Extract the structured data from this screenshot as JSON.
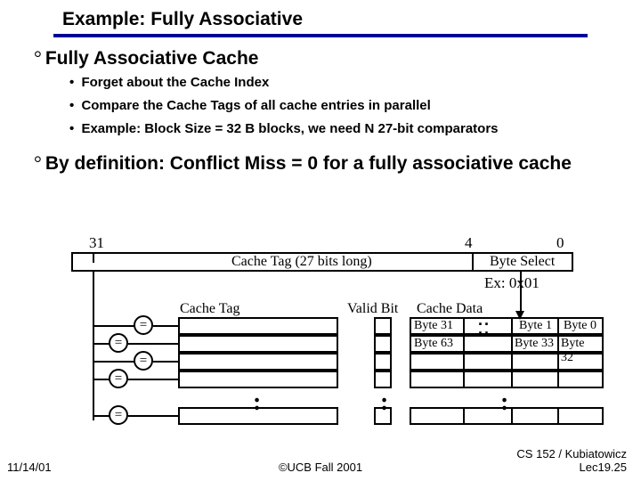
{
  "title": "Example: Fully Associative",
  "bullets": {
    "b1": "Fully Associative Cache",
    "b1_subs": {
      "s1": "Forget about the Cache Index",
      "s2": "Compare the Cache Tags of  all cache entries in parallel",
      "s3": "Example: Block Size = 32 B blocks, we need N 27-bit comparators"
    },
    "b2": "By definition: Conflict Miss = 0 for a fully associative cache"
  },
  "addr": {
    "bit_hi": "31",
    "bit_mid": "4",
    "bit_lo": "0",
    "tag_label": "Cache Tag (27 bits long)",
    "byte_select": "Byte Select",
    "example": "Ex: 0x01"
  },
  "headers": {
    "cache_tag": "Cache Tag",
    "valid_bit": "Valid Bit",
    "cache_data": "Cache Data"
  },
  "cmp_symbol": "=",
  "data_cells": {
    "r0c0": "Byte 31",
    "r0c1": "Byte 1",
    "r0c2": "Byte 0",
    "r1c0": "Byte 63",
    "r1c1": "Byte 33",
    "r1c2": "Byte 32"
  },
  "colon": ":",
  "footer": {
    "date": "11/14/01",
    "center": "©UCB Fall 2001",
    "right1": "CS 152 / Kubiatowicz",
    "right2": "Lec19.25"
  }
}
